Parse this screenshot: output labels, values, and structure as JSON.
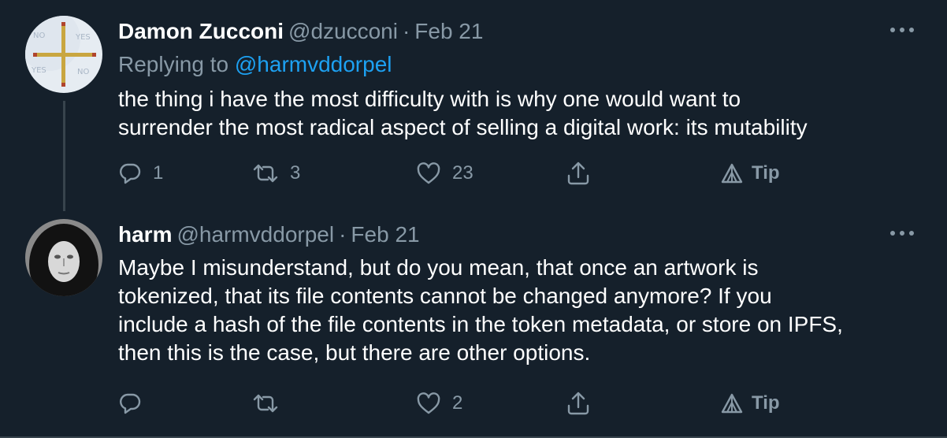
{
  "tweets": [
    {
      "author": {
        "name": "Damon Zucconi",
        "handle": "@dzucconi"
      },
      "date": "Feb 21",
      "separator": "·",
      "reply": {
        "prefix": "Replying to",
        "mention": "@harmvddorpel"
      },
      "text_lines": [
        "the thing i have the most difficulty with is why one would want to",
        "surrender the most radical aspect of selling a digital work: its mutability"
      ],
      "actions": {
        "reply_count": "1",
        "retweet_count": "3",
        "like_count": "23",
        "tip_label": "Tip"
      },
      "avatar_icon": "cross-sticks-avatar",
      "avatar_marks": [
        "NO",
        "YES",
        "YES",
        "NO"
      ]
    },
    {
      "author": {
        "name": "harm",
        "handle": "@harmvddorpel"
      },
      "date": "Feb 21",
      "separator": "·",
      "text_lines": [
        "Maybe I misunderstand, but do you mean, that once an artwork is",
        "tokenized, that its file contents cannot be changed anymore? If you",
        "include a hash of the file contents in the token metadata, or store on IPFS,",
        "then this is the case, but there are other options."
      ],
      "actions": {
        "reply_count": "",
        "retweet_count": "",
        "like_count": "2",
        "tip_label": "Tip"
      },
      "avatar_icon": "hooded-face-avatar"
    }
  ],
  "colors": {
    "background": "#15202b",
    "text": "#ffffff",
    "muted": "#8899a6",
    "link": "#1da1f2",
    "divider": "#38444d"
  },
  "icons": {
    "reply": "reply-icon",
    "retweet": "retweet-icon",
    "like": "heart-icon",
    "share": "share-icon",
    "tip": "tip-icon",
    "more": "more-dots-icon"
  }
}
